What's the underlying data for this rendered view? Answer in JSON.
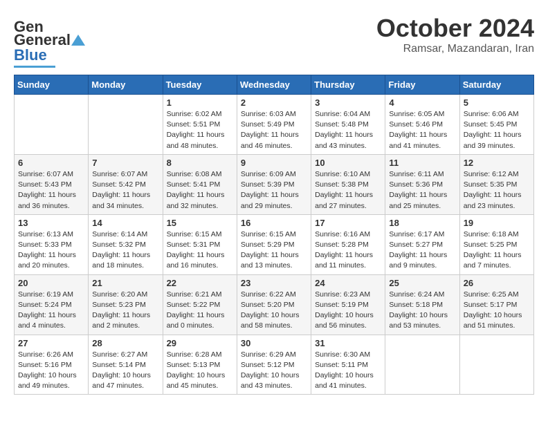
{
  "header": {
    "logo_line1": "General",
    "logo_line2": "Blue",
    "month_year": "October 2024",
    "location": "Ramsar, Mazandaran, Iran"
  },
  "days_of_week": [
    "Sunday",
    "Monday",
    "Tuesday",
    "Wednesday",
    "Thursday",
    "Friday",
    "Saturday"
  ],
  "weeks": [
    [
      {
        "day": "",
        "info": ""
      },
      {
        "day": "",
        "info": ""
      },
      {
        "day": "1",
        "info": "Sunrise: 6:02 AM\nSunset: 5:51 PM\nDaylight: 11 hours and 48 minutes."
      },
      {
        "day": "2",
        "info": "Sunrise: 6:03 AM\nSunset: 5:49 PM\nDaylight: 11 hours and 46 minutes."
      },
      {
        "day": "3",
        "info": "Sunrise: 6:04 AM\nSunset: 5:48 PM\nDaylight: 11 hours and 43 minutes."
      },
      {
        "day": "4",
        "info": "Sunrise: 6:05 AM\nSunset: 5:46 PM\nDaylight: 11 hours and 41 minutes."
      },
      {
        "day": "5",
        "info": "Sunrise: 6:06 AM\nSunset: 5:45 PM\nDaylight: 11 hours and 39 minutes."
      }
    ],
    [
      {
        "day": "6",
        "info": "Sunrise: 6:07 AM\nSunset: 5:43 PM\nDaylight: 11 hours and 36 minutes."
      },
      {
        "day": "7",
        "info": "Sunrise: 6:07 AM\nSunset: 5:42 PM\nDaylight: 11 hours and 34 minutes."
      },
      {
        "day": "8",
        "info": "Sunrise: 6:08 AM\nSunset: 5:41 PM\nDaylight: 11 hours and 32 minutes."
      },
      {
        "day": "9",
        "info": "Sunrise: 6:09 AM\nSunset: 5:39 PM\nDaylight: 11 hours and 29 minutes."
      },
      {
        "day": "10",
        "info": "Sunrise: 6:10 AM\nSunset: 5:38 PM\nDaylight: 11 hours and 27 minutes."
      },
      {
        "day": "11",
        "info": "Sunrise: 6:11 AM\nSunset: 5:36 PM\nDaylight: 11 hours and 25 minutes."
      },
      {
        "day": "12",
        "info": "Sunrise: 6:12 AM\nSunset: 5:35 PM\nDaylight: 11 hours and 23 minutes."
      }
    ],
    [
      {
        "day": "13",
        "info": "Sunrise: 6:13 AM\nSunset: 5:33 PM\nDaylight: 11 hours and 20 minutes."
      },
      {
        "day": "14",
        "info": "Sunrise: 6:14 AM\nSunset: 5:32 PM\nDaylight: 11 hours and 18 minutes."
      },
      {
        "day": "15",
        "info": "Sunrise: 6:15 AM\nSunset: 5:31 PM\nDaylight: 11 hours and 16 minutes."
      },
      {
        "day": "16",
        "info": "Sunrise: 6:15 AM\nSunset: 5:29 PM\nDaylight: 11 hours and 13 minutes."
      },
      {
        "day": "17",
        "info": "Sunrise: 6:16 AM\nSunset: 5:28 PM\nDaylight: 11 hours and 11 minutes."
      },
      {
        "day": "18",
        "info": "Sunrise: 6:17 AM\nSunset: 5:27 PM\nDaylight: 11 hours and 9 minutes."
      },
      {
        "day": "19",
        "info": "Sunrise: 6:18 AM\nSunset: 5:25 PM\nDaylight: 11 hours and 7 minutes."
      }
    ],
    [
      {
        "day": "20",
        "info": "Sunrise: 6:19 AM\nSunset: 5:24 PM\nDaylight: 11 hours and 4 minutes."
      },
      {
        "day": "21",
        "info": "Sunrise: 6:20 AM\nSunset: 5:23 PM\nDaylight: 11 hours and 2 minutes."
      },
      {
        "day": "22",
        "info": "Sunrise: 6:21 AM\nSunset: 5:22 PM\nDaylight: 11 hours and 0 minutes."
      },
      {
        "day": "23",
        "info": "Sunrise: 6:22 AM\nSunset: 5:20 PM\nDaylight: 10 hours and 58 minutes."
      },
      {
        "day": "24",
        "info": "Sunrise: 6:23 AM\nSunset: 5:19 PM\nDaylight: 10 hours and 56 minutes."
      },
      {
        "day": "25",
        "info": "Sunrise: 6:24 AM\nSunset: 5:18 PM\nDaylight: 10 hours and 53 minutes."
      },
      {
        "day": "26",
        "info": "Sunrise: 6:25 AM\nSunset: 5:17 PM\nDaylight: 10 hours and 51 minutes."
      }
    ],
    [
      {
        "day": "27",
        "info": "Sunrise: 6:26 AM\nSunset: 5:16 PM\nDaylight: 10 hours and 49 minutes."
      },
      {
        "day": "28",
        "info": "Sunrise: 6:27 AM\nSunset: 5:14 PM\nDaylight: 10 hours and 47 minutes."
      },
      {
        "day": "29",
        "info": "Sunrise: 6:28 AM\nSunset: 5:13 PM\nDaylight: 10 hours and 45 minutes."
      },
      {
        "day": "30",
        "info": "Sunrise: 6:29 AM\nSunset: 5:12 PM\nDaylight: 10 hours and 43 minutes."
      },
      {
        "day": "31",
        "info": "Sunrise: 6:30 AM\nSunset: 5:11 PM\nDaylight: 10 hours and 41 minutes."
      },
      {
        "day": "",
        "info": ""
      },
      {
        "day": "",
        "info": ""
      }
    ]
  ]
}
